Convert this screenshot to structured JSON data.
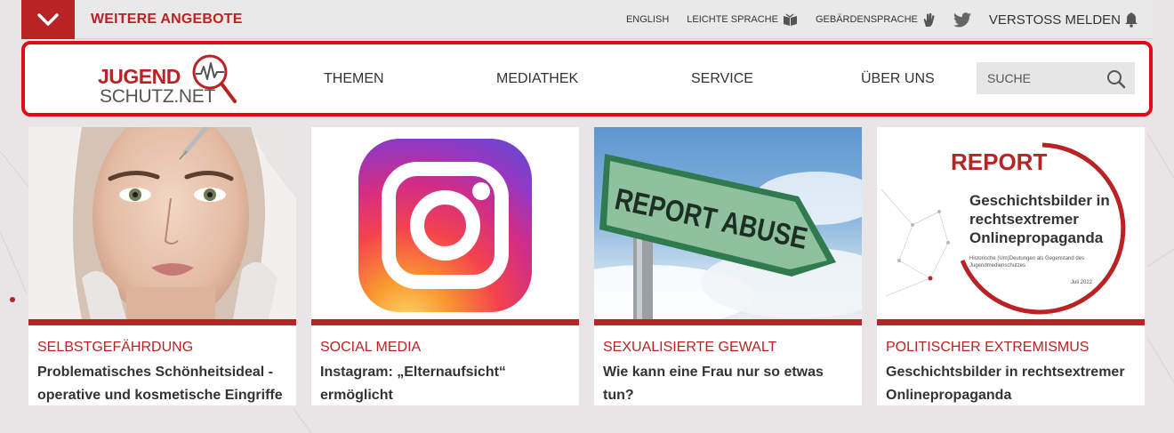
{
  "topbar": {
    "more_offers_label": "WEITERE ANGEBOTE",
    "links": [
      {
        "label": "ENGLISH",
        "icon": ""
      },
      {
        "label": "LEICHTE SPRACHE",
        "icon": "book-icon"
      },
      {
        "label": "GEBÄRDENSPRACHE",
        "icon": "hand-icon"
      }
    ],
    "twitter_icon": "twitter-icon",
    "report_label": "VERSTOSS MELDEN",
    "report_icon": "bell-icon"
  },
  "logo": {
    "line1": "JUGEND",
    "line2": "SCHUTZ.NET"
  },
  "nav": {
    "items": [
      "THEMEN",
      "MEDIATHEK",
      "SERVICE",
      "ÜBER UNS"
    ]
  },
  "search": {
    "placeholder": "SUCHE"
  },
  "cards": [
    {
      "category": "SELBSTGEFÄHRDUNG",
      "title": "Problematisches Schönheitsideal - operative und kosmetische Eingriffe"
    },
    {
      "category": "SOCIAL MEDIA",
      "title": "Instagram: „Elternaufsicht“ ermöglicht"
    },
    {
      "category": "SEXUALISIERTE GEWALT",
      "title": "Wie kann eine Frau nur so etwas tun?",
      "sign_text": "REPORT ABUSE"
    },
    {
      "category": "POLITISCHER EXTREMISMUS",
      "title": "Geschichtsbilder in rechtsextremer Onlinepropaganda",
      "cover": {
        "label": "REPORT",
        "title": "Geschichtsbilder in rechtsextremer Onlinepropaganda",
        "subtitle": "Historische (Um)Deutungen als Gegenstand des Jugendmedienschutzes",
        "date": "Juli 2022"
      }
    }
  ],
  "colors": {
    "brand_red": "#b92324",
    "highlight_border": "#e00c17"
  }
}
